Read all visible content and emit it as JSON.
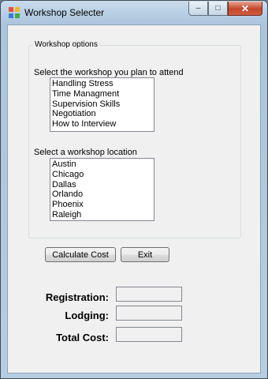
{
  "window": {
    "title": "Workshop Selecter",
    "minimize_label": "–",
    "maximize_label": "□",
    "close_label": "✕"
  },
  "group": {
    "legend": "Workshop options",
    "workshop_prompt": "Select the workshop you plan to attend",
    "workshops": [
      "Handling Stress",
      "Time Managment",
      "Supervision Skills",
      "Negotiation",
      "How to Interview"
    ],
    "location_prompt": "Select a workshop location",
    "locations": [
      "Austin",
      "Chicago",
      "Dallas",
      "Orlando",
      "Phoenix",
      "Raleigh"
    ]
  },
  "buttons": {
    "calculate_label": "Calculate Cost",
    "exit_label": "Exit"
  },
  "results": {
    "registration_label": "Registration:",
    "registration_value": "",
    "lodging_label": "Lodging:",
    "lodging_value": "",
    "total_label": "Total Cost:",
    "total_value": ""
  }
}
